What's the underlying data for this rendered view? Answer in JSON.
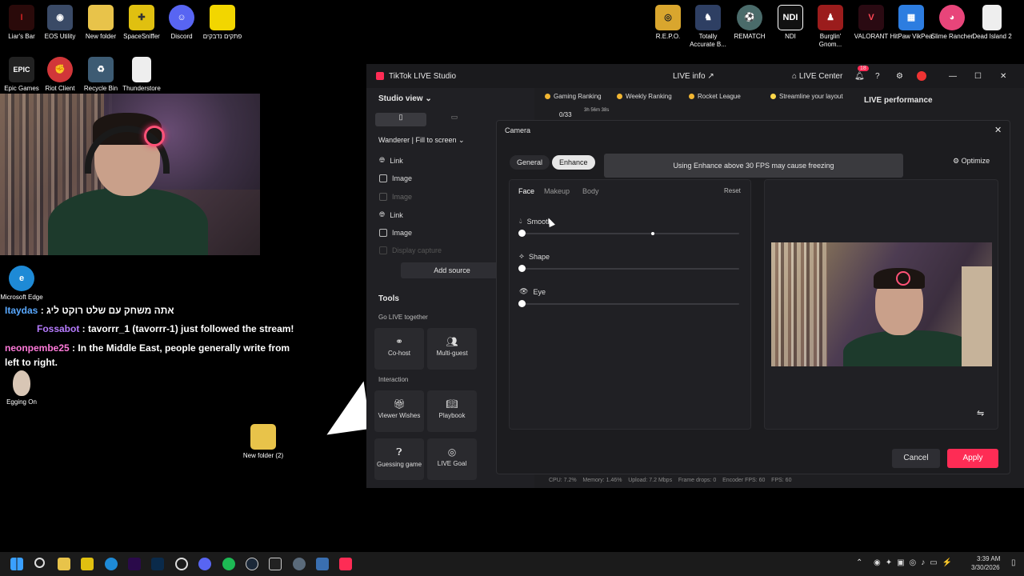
{
  "desktop_icons": [
    {
      "label": "Liar's Bar",
      "icon": "liars-bar-icon",
      "color": "#2a0a0a"
    },
    {
      "label": "EOS Utility",
      "icon": "camera-icon",
      "color": "#3a4a66"
    },
    {
      "label": "New folder",
      "icon": "folder-icon",
      "color": "#e8c34a"
    },
    {
      "label": "SpaceSniffer",
      "icon": "puzzle-icon",
      "color": "#e0c010"
    },
    {
      "label": "Discord",
      "icon": "discord-icon",
      "color": "#5865f2"
    },
    {
      "label": "פתקים נדבקים",
      "icon": "sticky-notes-icon",
      "color": "#f2d600"
    },
    {
      "label": "Epic Games",
      "icon": "epic-icon",
      "color": "#222222"
    },
    {
      "label": "Riot Client",
      "icon": "riot-icon",
      "color": "#d13639"
    },
    {
      "label": "Recycle Bin",
      "icon": "recycle-bin-icon",
      "color": "#3d5b73"
    },
    {
      "label": "Thunderstore",
      "icon": "file-icon",
      "color": "#eeeeee"
    },
    {
      "label": "R.E.P.O.",
      "icon": "repo-icon",
      "color": "#d9a62e"
    },
    {
      "label": "Totally Accurate B...",
      "icon": "tabs-icon",
      "color": "#2e3f63"
    },
    {
      "label": "REMATCH",
      "icon": "rematch-icon",
      "color": "#4a6b6a"
    },
    {
      "label": "NDI",
      "icon": "ndi-icon",
      "color": "#111111"
    },
    {
      "label": "Burglin' Gnom...",
      "icon": "burglin-icon",
      "color": "#9b1c1c"
    },
    {
      "label": "VALORANT",
      "icon": "valorant-icon",
      "color": "#2a0a12"
    },
    {
      "label": "HitPaw VikPea",
      "icon": "hitpaw-icon",
      "color": "#2d7de0"
    },
    {
      "label": "Slime Rancher",
      "icon": "slime-icon",
      "color": "#e8457a"
    },
    {
      "label": "Dead Island 2",
      "icon": "file-icon",
      "color": "#eeeeee"
    },
    {
      "label": "Microsoft Edge",
      "icon": "edge-icon",
      "color": "#1e8ad6"
    },
    {
      "label": "Egging On",
      "icon": "egg-icon",
      "color": "#d8c6b5"
    },
    {
      "label": "New folder (2)",
      "icon": "folder-icon",
      "color": "#e8c34a"
    }
  ],
  "chat": [
    {
      "user": "Itaydas",
      "text": " : אתה משחק עם שלט רוקט ליג"
    },
    {
      "user": "Fossabot",
      "text": " : tavorrr_1 (tavorrr-1) just followed the stream!"
    },
    {
      "user": "neonpembe25",
      "text": " : In the Middle East, people generally write from left to right."
    }
  ],
  "studio": {
    "title": "TikTok LIVE Studio",
    "live_info": "LIVE info",
    "live_center": "LIVE Center",
    "notif_count": "18",
    "studio_view": "Studio view",
    "scene": "Wanderer | Fill to screen",
    "sources": [
      "Link",
      "Image",
      "Image",
      "Link",
      "Image",
      "Display capture"
    ],
    "add_source": "Add source",
    "tools_title": "Tools",
    "go_live_together": "Go LIVE together",
    "cohost": "Co-host",
    "multiguest": "Multi-guest",
    "interaction": "Interaction",
    "viewer_wishes": "Viewer Wishes",
    "playbook": "Playbook",
    "guessing_game": "Guessing game",
    "live_goal": "LIVE Goal",
    "pills": [
      "Gaming Ranking",
      "Weekly Ranking",
      "Rocket League",
      "Streamline your layout"
    ],
    "counter": "0/33",
    "timer": "3h 56m 38s",
    "live_performance": "LIVE performance",
    "status": "CPU: 7.2%    Memory: 1.46%    Upload: 7.2 Mbps    Frame drops: 0    Encoder FPS: 60    FPS: 60"
  },
  "dialog": {
    "title": "Camera",
    "tabs": [
      "General",
      "Enhance"
    ],
    "active_tab": "Enhance",
    "toast": "Using Enhance above 30 FPS may cause freezing",
    "optimize": "Optimize",
    "subtabs": [
      "Face",
      "Makeup",
      "Body"
    ],
    "reset": "Reset",
    "sliders": [
      {
        "label": "Smooth",
        "value": 0
      },
      {
        "label": "Shape",
        "value": 0
      },
      {
        "label": "Eye",
        "value": 0
      }
    ],
    "cancel": "Cancel",
    "apply": "Apply",
    "accent": "#fe2c55"
  },
  "taskbar": {
    "time": "3:39 AM",
    "date": "3/30/2026"
  }
}
